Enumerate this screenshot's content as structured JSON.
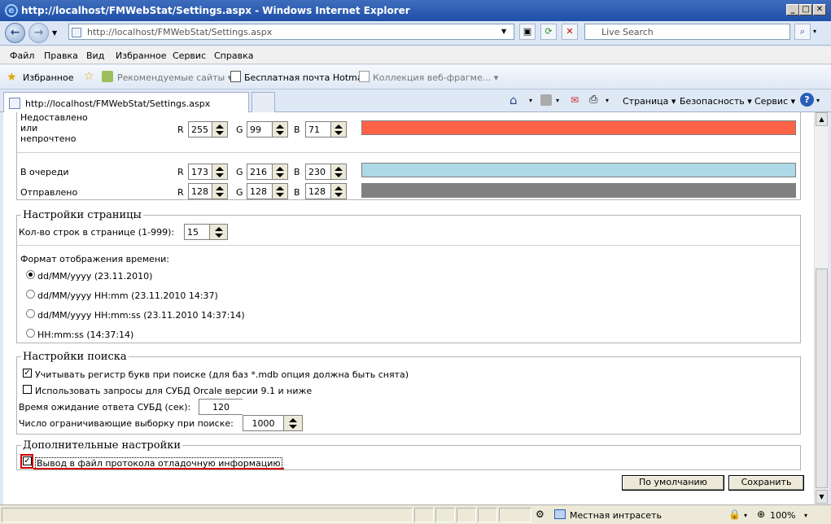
{
  "window": {
    "title": "http://localhost/FMWebStat/Settings.aspx - Windows Internet Explorer",
    "minimize": "_",
    "maximize": "□",
    "close": "✕"
  },
  "addressbar": {
    "url": "http://localhost/FMWebStat/Settings.aspx",
    "search_placeholder": "Live Search"
  },
  "menu": [
    "Файл",
    "Правка",
    "Вид",
    "Избранное",
    "Сервис",
    "Справка"
  ],
  "favorites": {
    "label": "Избранное",
    "items": [
      "Рекомендуемые сайты ▾",
      "Бесплатная почта Hotmail",
      "Коллекция веб-фрагме... ▾"
    ]
  },
  "tab": {
    "title": "http://localhost/FMWebStat/Settings.aspx"
  },
  "commandbar": [
    "Страница ▾",
    "Безопасность ▾",
    "Сервис ▾"
  ],
  "colors": {
    "rows": [
      {
        "label": "Недоставлено или непрочтено",
        "label_lines": [
          "Недоставлено",
          "или",
          "непрочтено"
        ],
        "r": "255",
        "g": "99",
        "b": "71",
        "swatch": "#ff6347"
      },
      {
        "label": "В очереди",
        "r": "173",
        "g": "216",
        "b": "230",
        "swatch": "#add8e6"
      },
      {
        "label": "Отправлено",
        "r": "128",
        "g": "128",
        "b": "128",
        "swatch": "#808080"
      }
    ],
    "r_label": "R",
    "g_label": "G",
    "b_label": "B"
  },
  "page_settings": {
    "legend": "Настройки страницы",
    "rows_label": "Кол-во строк в странице (1-999):",
    "rows_value": "15",
    "time_format_label": "Формат отображения времени:",
    "time_formats": [
      {
        "label": "dd/MM/yyyy (23.11.2010)",
        "selected": true
      },
      {
        "label": "dd/MM/yyyy HH:mm (23.11.2010 14:37)",
        "selected": false
      },
      {
        "label": "dd/MM/yyyy HH:mm:ss (23.11.2010 14:37:14)",
        "selected": false
      },
      {
        "label": "HH:mm:ss (14:37:14)",
        "selected": false
      }
    ]
  },
  "search_settings": {
    "legend": "Настройки поиска",
    "case_label": "Учитывать регистр букв при поиске (для баз *.mdb опция должна быть снята)",
    "case_checked": true,
    "oracle_label": "Использовать запросы для СУБД Orcale версии 9.1 и ниже",
    "oracle_checked": false,
    "timeout_label": "Время ожидание ответа СУБД (сек):",
    "timeout_value": "120",
    "limit_label": "Число ограничивающие выборку при поиске:",
    "limit_value": "1000"
  },
  "extra_settings": {
    "legend": "Дополнительные настройки",
    "debug_label": "Вывод в файл протокола отладочную информацию",
    "debug_checked": true
  },
  "buttons": {
    "default": "По умолчанию",
    "save": "Сохранить"
  },
  "statusbar": {
    "zone": "Местная интрасеть",
    "zoom": "100%"
  }
}
